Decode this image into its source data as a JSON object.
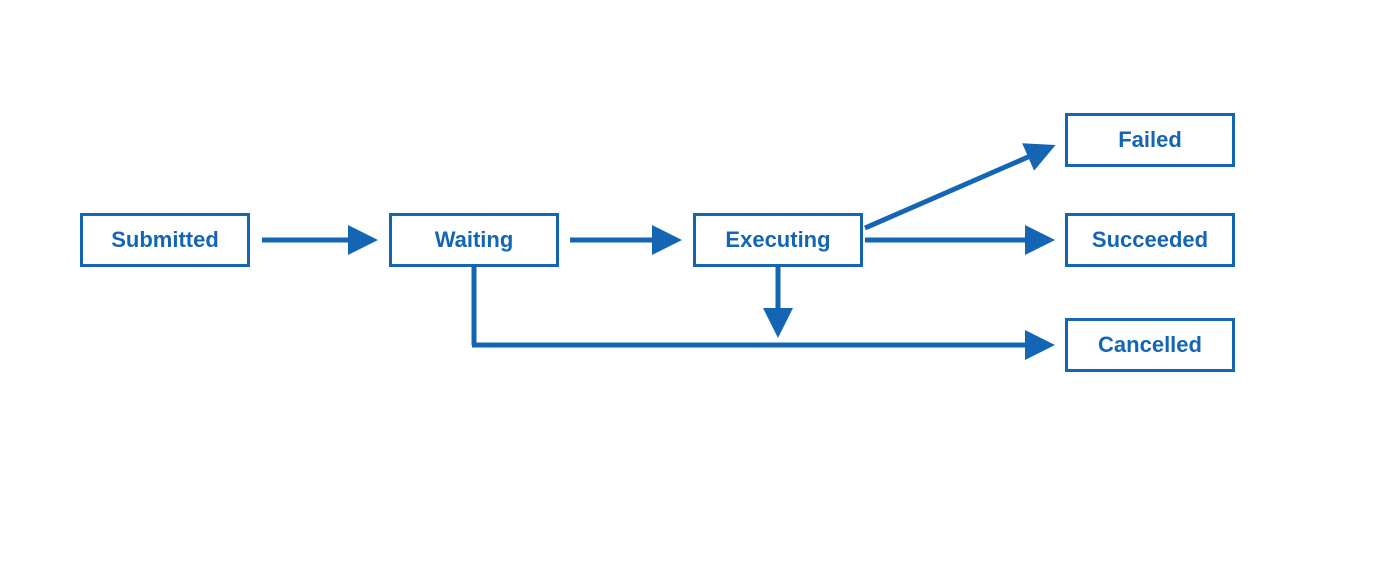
{
  "states": {
    "submitted": "Submitted",
    "waiting": "Waiting",
    "executing": "Executing",
    "failed": "Failed",
    "succeeded": "Succeeded",
    "cancelled": "Cancelled"
  },
  "color": "#1565b5",
  "transitions": [
    {
      "from": "submitted",
      "to": "waiting"
    },
    {
      "from": "waiting",
      "to": "executing"
    },
    {
      "from": "executing",
      "to": "failed"
    },
    {
      "from": "executing",
      "to": "succeeded"
    },
    {
      "from": "executing",
      "to": "cancelled"
    },
    {
      "from": "waiting",
      "to": "cancelled"
    }
  ]
}
